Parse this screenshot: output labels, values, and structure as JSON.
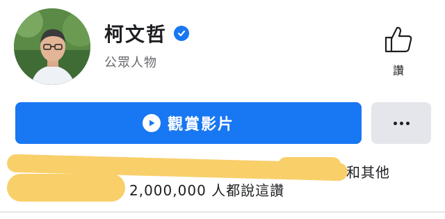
{
  "profile": {
    "name": "柯文哲",
    "category": "公眾人物"
  },
  "like_button": {
    "label": "讚"
  },
  "actions": {
    "watch_video_label": "觀賞影片"
  },
  "likes_summary": {
    "others_text": "和其他",
    "count_text": "2,000,000 人都說這讚"
  },
  "colors": {
    "primary": "#1877f2",
    "secondary_button": "#e4e6eb",
    "redaction": "#f9cf6a"
  }
}
